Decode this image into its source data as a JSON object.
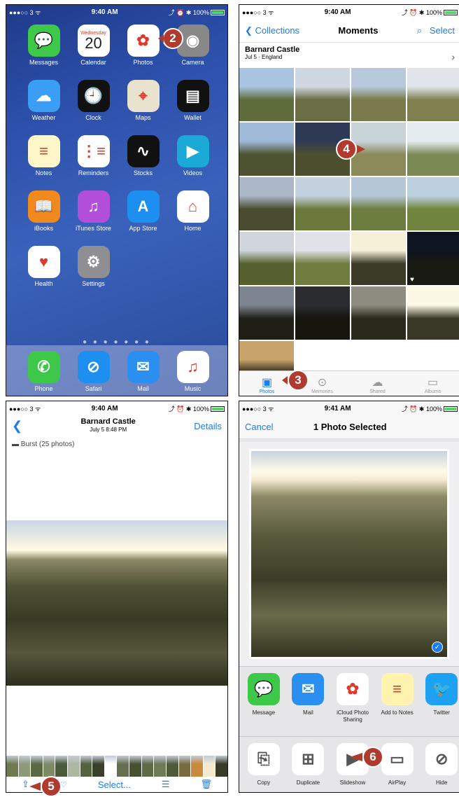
{
  "home": {
    "status": {
      "carrier": "●●●○○ 3 ᯤ",
      "time": "9:40 AM",
      "battery": "⤴ ⏰ ✱ 100%"
    },
    "apps": [
      {
        "label": "Messages",
        "color": "#3dc84a",
        "glyph": "💬"
      },
      {
        "label": "Calendar",
        "color": "#ffffff",
        "glyph": "20",
        "sub": "Wednesday"
      },
      {
        "label": "Photos",
        "color": "#ffffff",
        "glyph": "✿"
      },
      {
        "label": "Camera",
        "color": "#888888",
        "glyph": "◉"
      },
      {
        "label": "Weather",
        "color": "#3a9ef5",
        "glyph": "☁"
      },
      {
        "label": "Clock",
        "color": "#111111",
        "glyph": "🕘"
      },
      {
        "label": "Maps",
        "color": "#e8e2cf",
        "glyph": "⌖"
      },
      {
        "label": "Wallet",
        "color": "#111111",
        "glyph": "▤"
      },
      {
        "label": "Notes",
        "color": "#fff6c9",
        "glyph": "≡"
      },
      {
        "label": "Reminders",
        "color": "#ffffff",
        "glyph": "⋮≡"
      },
      {
        "label": "Stocks",
        "color": "#111111",
        "glyph": "∿"
      },
      {
        "label": "Videos",
        "color": "#1ba9d8",
        "glyph": "▶"
      },
      {
        "label": "iBooks",
        "color": "#f08a1c",
        "glyph": "📖"
      },
      {
        "label": "iTunes Store",
        "color": "#b14fd8",
        "glyph": "♫"
      },
      {
        "label": "App Store",
        "color": "#1d8ff1",
        "glyph": "A"
      },
      {
        "label": "Home",
        "color": "#ffffff",
        "glyph": "⌂"
      },
      {
        "label": "Health",
        "color": "#ffffff",
        "glyph": "♥"
      },
      {
        "label": "Settings",
        "color": "#8e8e93",
        "glyph": "⚙"
      }
    ],
    "dock": [
      {
        "label": "Phone",
        "color": "#3dc84a",
        "glyph": "✆"
      },
      {
        "label": "Safari",
        "color": "#1d8ff1",
        "glyph": "⊘"
      },
      {
        "label": "Mail",
        "color": "#2b8ff2",
        "glyph": "✉"
      },
      {
        "label": "Music",
        "color": "#ffffff",
        "glyph": "♫"
      }
    ],
    "page_dots": "● ● ● ● ● ● ●"
  },
  "moments": {
    "status": {
      "carrier": "●●●○○ 3 ᯤ",
      "time": "9:40 AM",
      "battery": "⤴ ⏰ ✱ 100%"
    },
    "back": "Collections",
    "title": "Moments",
    "select": "Select",
    "place": "Barnard Castle",
    "date": "Jul 5 · England",
    "tabs": [
      "Photos",
      "Memories",
      "Shared",
      "Albums"
    ]
  },
  "detail": {
    "status": {
      "carrier": "●●●○○ 3 ᯤ",
      "time": "9:40 AM",
      "battery": "⤴ ⏰ ✱ 100%"
    },
    "title": "Barnard Castle",
    "subtitle": "July 5  8:48 PM",
    "details": "Details",
    "burst": "Burst (25 photos)",
    "select": "Select..."
  },
  "share": {
    "status": {
      "carrier": "●●●○○ 3 ᯤ",
      "time": "9:41 AM",
      "battery": "⤴ ⏰ ✱ 100%"
    },
    "cancel": "Cancel",
    "title": "1 Photo Selected",
    "apps": [
      {
        "label": "Message",
        "color": "#3dc84a",
        "glyph": "💬"
      },
      {
        "label": "Mail",
        "color": "#2b8ff2",
        "glyph": "✉"
      },
      {
        "label": "iCloud Photo Sharing",
        "color": "#ffffff",
        "glyph": "✿"
      },
      {
        "label": "Add to Notes",
        "color": "#fff3b0",
        "glyph": "≡"
      },
      {
        "label": "Twitter",
        "color": "#1da1f2",
        "glyph": "🐦"
      }
    ],
    "actions": [
      {
        "label": "Copy",
        "glyph": "⎘"
      },
      {
        "label": "Duplicate",
        "glyph": "⊞"
      },
      {
        "label": "Slideshow",
        "glyph": "▶"
      },
      {
        "label": "AirPlay",
        "glyph": "▭"
      },
      {
        "label": "Hide",
        "glyph": "⊘"
      }
    ]
  },
  "callouts": [
    "2",
    "3",
    "4",
    "5",
    "6"
  ]
}
